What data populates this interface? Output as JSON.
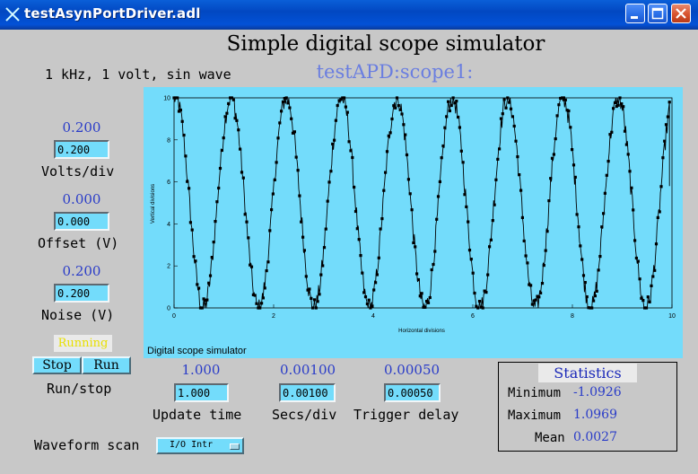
{
  "window": {
    "title": "testAsynPortDriver.adl",
    "icon": "x-cross-icon"
  },
  "header": {
    "title": "Simple digital scope simulator",
    "subtitle": "1 kHz, 1 volt, sin wave",
    "pv_prefix": "testAPD:scope1:"
  },
  "controls": {
    "volts_div": {
      "readback": "0.200",
      "value": "0.200",
      "label": "Volts/div"
    },
    "offset": {
      "readback": "0.000",
      "value": "0.000",
      "label": "Offset (V)"
    },
    "noise": {
      "readback": "0.200",
      "value": "0.200",
      "label": "Noise (V)"
    },
    "run": {
      "status": "Running",
      "stop_label": "Stop",
      "run_label": "Run",
      "label": "Run/stop"
    },
    "update_time": {
      "readback": "1.000",
      "value": "1.000",
      "label": "Update time"
    },
    "secs_div": {
      "readback": "0.00100",
      "value": "0.00100",
      "label": "Secs/div"
    },
    "trigger_delay": {
      "readback": "0.00050",
      "value": "0.00050",
      "label": "Trigger delay"
    },
    "waveform_scan": {
      "label": "Waveform scan",
      "value": "I/O Intr"
    }
  },
  "statistics": {
    "title": "Statistics",
    "minimum_label": "Minimum",
    "minimum_value": "-1.0926",
    "maximum_label": "Maximum",
    "maximum_value": "1.0969",
    "mean_label": "Mean",
    "mean_value": "0.0027"
  },
  "colors": {
    "entry_bg": "#73dcfb",
    "readback_text": "#2a3cc8",
    "running_text": "#e8e000",
    "screen_bg": "#c8c8c8"
  },
  "chart_data": {
    "type": "line",
    "title": "Digital scope simulator",
    "xlabel": "Horizontal divisions",
    "ylabel": "Vertical divisions",
    "xlim": [
      0,
      10
    ],
    "ylim": [
      0,
      10
    ],
    "xticks": [
      "0",
      "2",
      "4",
      "6",
      "8",
      "10"
    ],
    "yticks": [
      "0",
      "2",
      "4",
      "6",
      "8",
      "10"
    ],
    "grid": false,
    "series": [
      {
        "amplitude_div": 5,
        "center_div": 5,
        "cycles": 9,
        "phase_start_div": 4.2,
        "end_x": 9.95,
        "end_y": 5.8,
        "marker": "square",
        "color": "#000000"
      }
    ]
  }
}
